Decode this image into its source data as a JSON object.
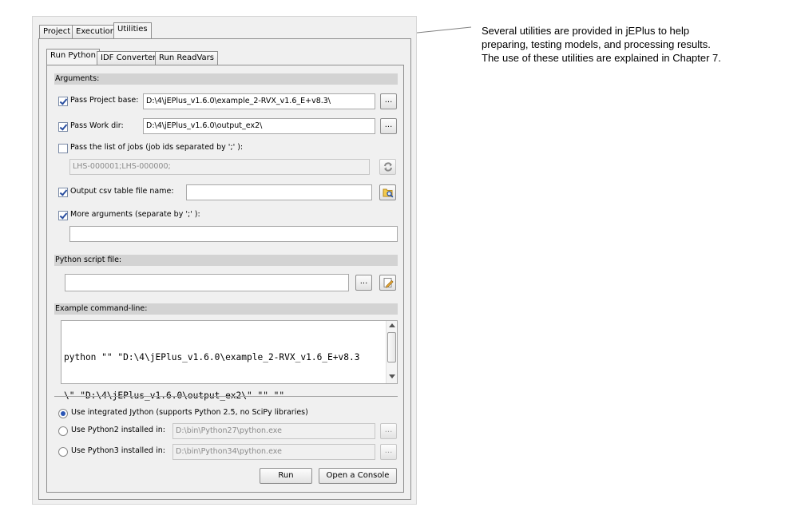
{
  "tabs": {
    "main": [
      "Project",
      "Execution",
      "Utilities"
    ],
    "sub": [
      "Run Python",
      "IDF Converter",
      "Run ReadVars"
    ]
  },
  "arguments": {
    "header": "Arguments:",
    "project_base": {
      "checked": true,
      "label": "Pass Project base:",
      "value": "D:\\4\\jEPlus_v1.6.0\\example_2-RVX_v1.6_E+v8.3\\",
      "browse_label": "..."
    },
    "work_dir": {
      "checked": true,
      "label": "Pass Work dir:",
      "value": "D:\\4\\jEPlus_v1.6.0\\output_ex2\\",
      "browse_label": "..."
    },
    "job_list": {
      "checked": false,
      "label": "Pass the list of jobs (job ids separated by ';' ):",
      "value": "LHS-000001;LHS-000000;"
    },
    "output_csv": {
      "checked": true,
      "label": "Output csv table file name:",
      "value": ""
    },
    "more_args": {
      "checked": true,
      "label": "More arguments (separate by ';' ):",
      "value": ""
    }
  },
  "script": {
    "header": "Python script file:",
    "value": "",
    "browse_label": "..."
  },
  "example": {
    "header": "Example command-line:",
    "line1": "python \"\" \"D:\\4\\jEPlus_v1.6.0\\example_2-RVX_v1.6_E+v8.3",
    "line2": "\\\" \"D:\\4\\jEPlus_v1.6.0\\output_ex2\\\" \"\" \"\""
  },
  "interpreters": {
    "jython": {
      "selected": true,
      "label": "Use integrated Jython (supports Python 2.5, no SciPy libraries)"
    },
    "python2": {
      "selected": false,
      "label": "Use Python2 installed in:",
      "path": "D:\\bin\\Python27\\python.exe",
      "browse_label": "..."
    },
    "python3": {
      "selected": false,
      "label": "Use Python3 installed in:",
      "path": "D:\\bin\\Python34\\python.exe",
      "browse_label": "..."
    }
  },
  "buttons": {
    "run": "Run",
    "console": "Open a Console"
  },
  "annotation": "Several utilities are provided in jEPlus to help\npreparing, testing models, and processing results.\nThe use of these utilities are explained in Chapter 7.",
  "colors": {
    "section_bar": "#d3d3d3",
    "panel_bg": "#f0f0f0",
    "leader_line": "#808080"
  }
}
